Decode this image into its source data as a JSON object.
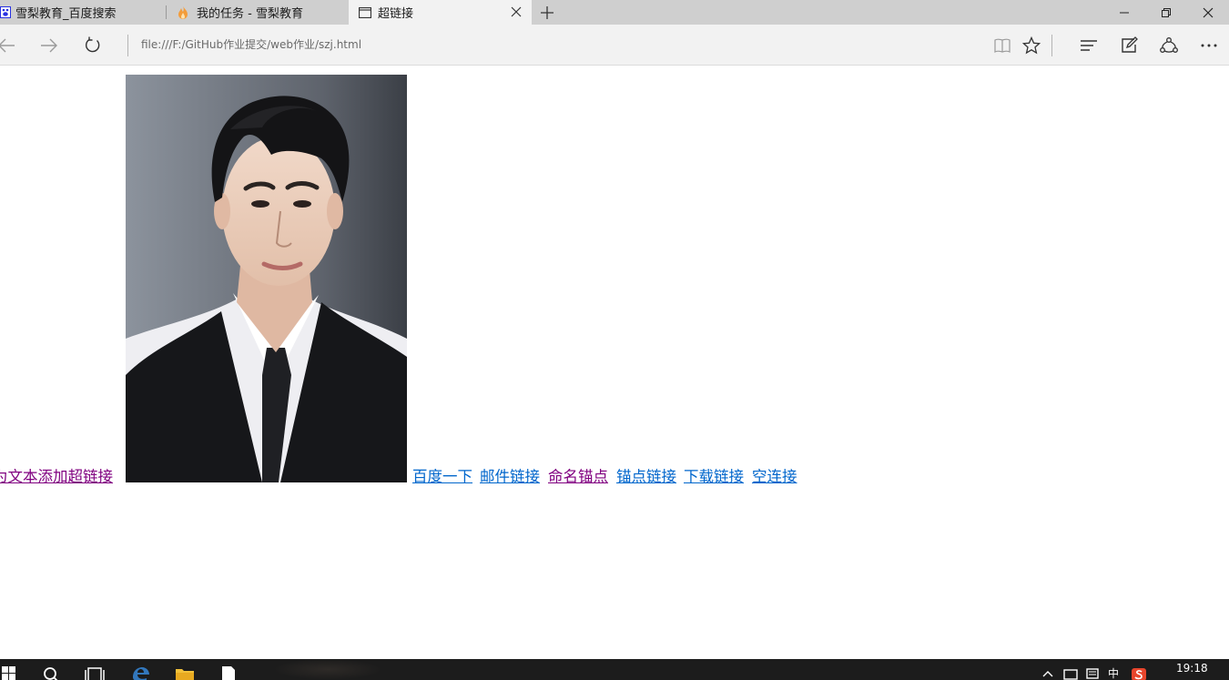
{
  "tabs": [
    {
      "title": "雪梨教育_百度搜索",
      "icon": "baidu-paw-icon"
    },
    {
      "title": "我的任务 - 雪梨教育",
      "icon": "flame-icon"
    },
    {
      "title": "超链接",
      "icon": "page-icon",
      "active": true
    }
  ],
  "address": {
    "url": "file:///F:/GitHub作业提交/web作业/szj.html"
  },
  "page": {
    "links": [
      {
        "text": "为文本添加超链接",
        "state": "visited"
      },
      {
        "text": "百度一下",
        "state": "normal"
      },
      {
        "text": "邮件链接",
        "state": "normal"
      },
      {
        "text": "命名锚点",
        "state": "visited"
      },
      {
        "text": "锚点链接",
        "state": "normal"
      },
      {
        "text": "下载链接",
        "state": "normal"
      },
      {
        "text": "空连接",
        "state": "normal"
      }
    ],
    "image_alt": "portrait photo link"
  },
  "taskbar": {
    "clock": "19:18",
    "ime": "中",
    "tray_icons": [
      "up-chevron-icon",
      "network-icon",
      "notification-icon",
      "ime-icon",
      "sogou-icon"
    ]
  },
  "colors": {
    "visited_link": "#800080",
    "link": "#0066cc",
    "tabbar": "#cfcfcf",
    "active_tab": "#f2f2f2",
    "taskbar": "#1c1c1c"
  }
}
